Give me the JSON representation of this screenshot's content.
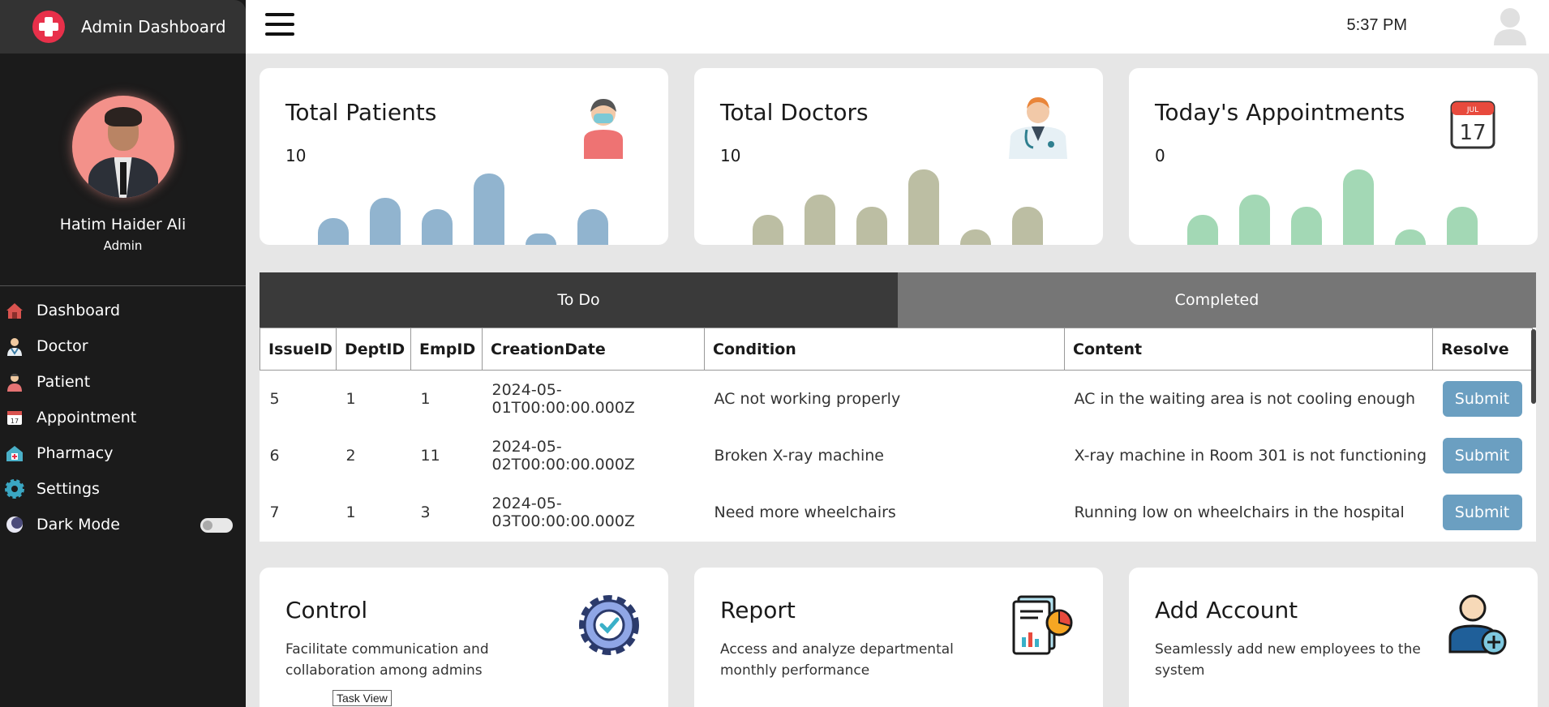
{
  "brand": {
    "title": "Admin Dashboard"
  },
  "profile": {
    "name": "Hatim Haider Ali",
    "role": "Admin"
  },
  "nav": {
    "items": [
      {
        "label": "Dashboard",
        "icon": "house-icon"
      },
      {
        "label": "Doctor",
        "icon": "doctor-icon"
      },
      {
        "label": "Patient",
        "icon": "patient-icon"
      },
      {
        "label": "Appointment",
        "icon": "calendar-icon"
      },
      {
        "label": "Pharmacy",
        "icon": "pharmacy-icon"
      },
      {
        "label": "Settings",
        "icon": "gear-icon"
      },
      {
        "label": "Dark Mode",
        "icon": "moon-icon"
      }
    ],
    "dark_mode_on": false
  },
  "topbar": {
    "time": "5:37 PM"
  },
  "stats": [
    {
      "title": "Total Patients",
      "value": "10",
      "icon": "patient-icon",
      "bar_color": "#91b4cf",
      "bars": [
        0.33,
        0.58,
        0.44,
        0.88,
        0.14,
        0.44
      ]
    },
    {
      "title": "Total Doctors",
      "value": "10",
      "icon": "doctor-icon",
      "bar_color": "#bcbea3",
      "bars": [
        0.37,
        0.62,
        0.47,
        0.93,
        0.19,
        0.47
      ]
    },
    {
      "title": "Today's Appointments",
      "value": "0",
      "icon": "calendar-icon",
      "bar_color": "#a3d8b5",
      "bars": [
        0.37,
        0.62,
        0.47,
        0.93,
        0.19,
        0.47
      ]
    }
  ],
  "calendar_icon": {
    "month": "JUL",
    "day": "17"
  },
  "tabs": {
    "todo": "To Do",
    "completed": "Completed"
  },
  "table": {
    "headers": [
      "IssueID",
      "DeptID",
      "EmpID",
      "CreationDate",
      "Condition",
      "Content",
      "Resolve"
    ],
    "rows": [
      {
        "issue": "5",
        "dept": "1",
        "emp": "1",
        "date": "2024-05-01T00:00:00.000Z",
        "condition": "AC not working properly",
        "content": "AC in the waiting area is not cooling enough",
        "action": "Submit"
      },
      {
        "issue": "6",
        "dept": "2",
        "emp": "11",
        "date": "2024-05-02T00:00:00.000Z",
        "condition": "Broken X-ray machine",
        "content": "X-ray machine in Room 301 is not functioning",
        "action": "Submit"
      },
      {
        "issue": "7",
        "dept": "1",
        "emp": "3",
        "date": "2024-05-03T00:00:00.000Z",
        "condition": "Need more wheelchairs",
        "content": "Running low on wheelchairs in the hospital",
        "action": "Submit"
      }
    ]
  },
  "features": [
    {
      "title": "Control",
      "desc": "Facilitate communication and collaboration among admins",
      "icon": "gear-check-icon"
    },
    {
      "title": "Report",
      "desc": "Access and analyze departmental monthly performance",
      "icon": "report-chart-icon"
    },
    {
      "title": "Add Account",
      "desc": "Seamlessly add new employees to the system",
      "icon": "add-user-icon"
    }
  ],
  "tooltip": "Task View"
}
